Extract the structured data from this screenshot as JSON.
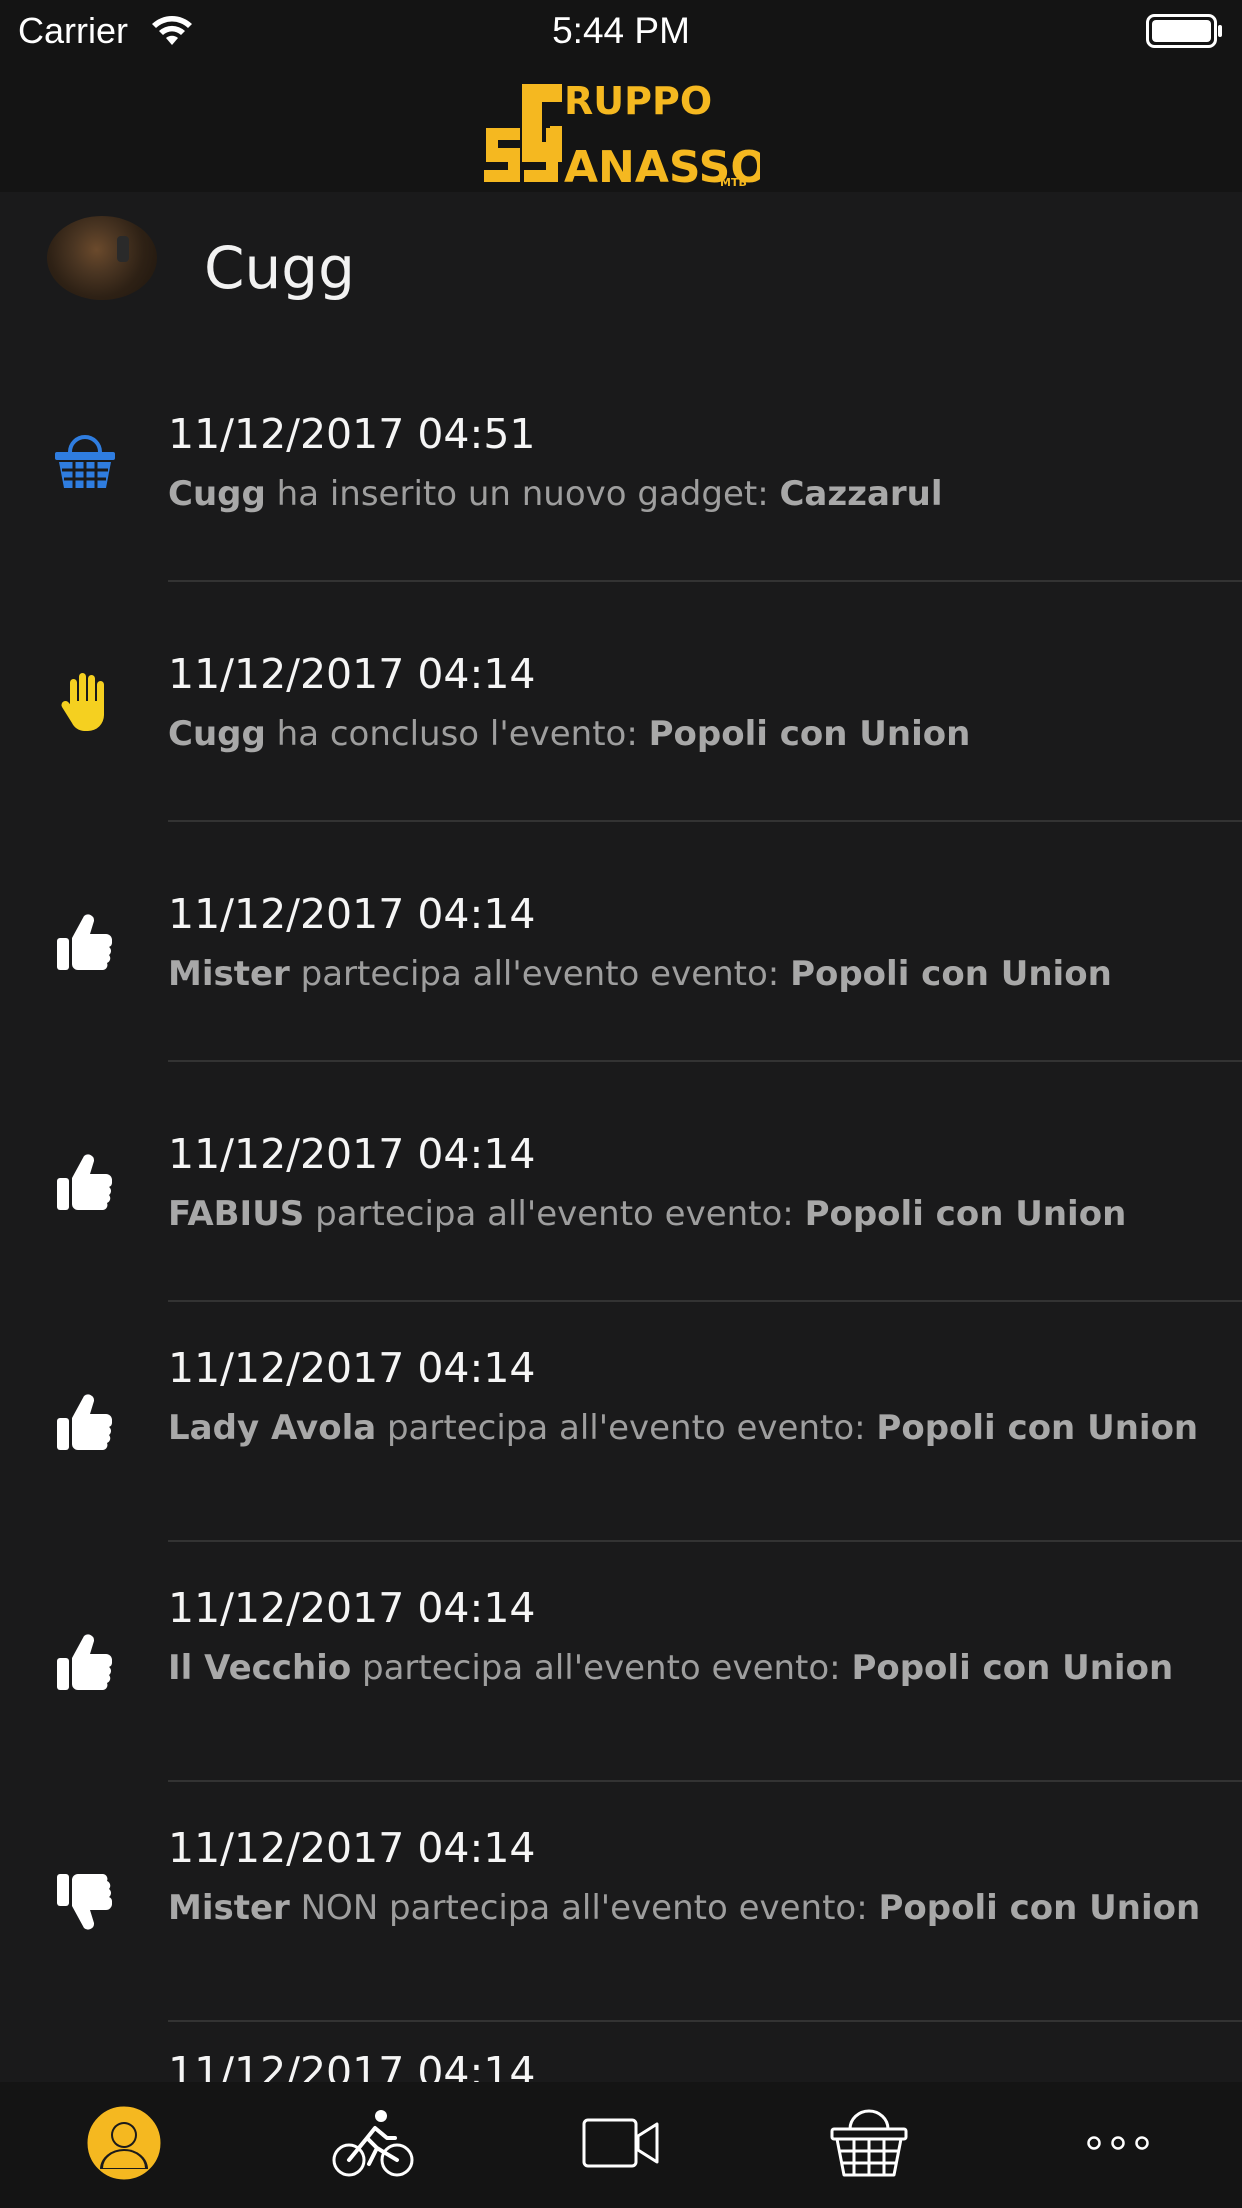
{
  "status_bar": {
    "carrier": "Carrier",
    "time": "5:44 PM"
  },
  "header": {
    "logo_text_top": "RUPPO",
    "logo_text_bottom": "ANASSO",
    "logo_text_small": "MTB",
    "logo_color": "#f5b820"
  },
  "profile": {
    "name": "Cugg"
  },
  "feed": [
    {
      "icon": "basket-icon",
      "date": "11/12/2017 04:51",
      "actor": "Cugg",
      "action": " ha inserito un nuovo gadget: ",
      "object": "Cazzarul"
    },
    {
      "icon": "hand-stop-icon",
      "date": "11/12/2017 04:14",
      "actor": "Cugg",
      "action": " ha concluso l'evento: ",
      "object": "Popoli con Union"
    },
    {
      "icon": "thumbs-up-icon",
      "date": "11/12/2017 04:14",
      "actor": "Mister",
      "action": " partecipa all'evento evento: ",
      "object": "Popoli con Union"
    },
    {
      "icon": "thumbs-up-icon",
      "date": "11/12/2017 04:14",
      "actor": "FABIUS",
      "action": " partecipa all'evento evento: ",
      "object": "Popoli con Union"
    },
    {
      "icon": "thumbs-up-icon",
      "date": "11/12/2017 04:14",
      "actor": "Lady Avola",
      "action": " partecipa all'evento evento: ",
      "object": "Popoli con Union"
    },
    {
      "icon": "thumbs-up-icon",
      "date": "11/12/2017 04:14",
      "actor": "Il Vecchio",
      "action": " partecipa all'evento evento: ",
      "object": "Popoli con Union"
    },
    {
      "icon": "thumbs-down-icon",
      "date": "11/12/2017 04:14",
      "actor": "Mister",
      "action": " NON partecipa all'evento evento: ",
      "object": "Popoli con Union"
    },
    {
      "icon": "",
      "date": "11/12/2017 04:14",
      "actor": "",
      "action": "",
      "object": ""
    }
  ],
  "tabbar": {
    "tabs": [
      "profile-icon",
      "bike-icon",
      "video-icon",
      "shop-icon",
      "more-icon"
    ],
    "active_color": "#f5b820"
  },
  "colors": {
    "basket_icon": "#2f7de0",
    "hand_icon": "#f5d020",
    "accent": "#f5b820"
  }
}
